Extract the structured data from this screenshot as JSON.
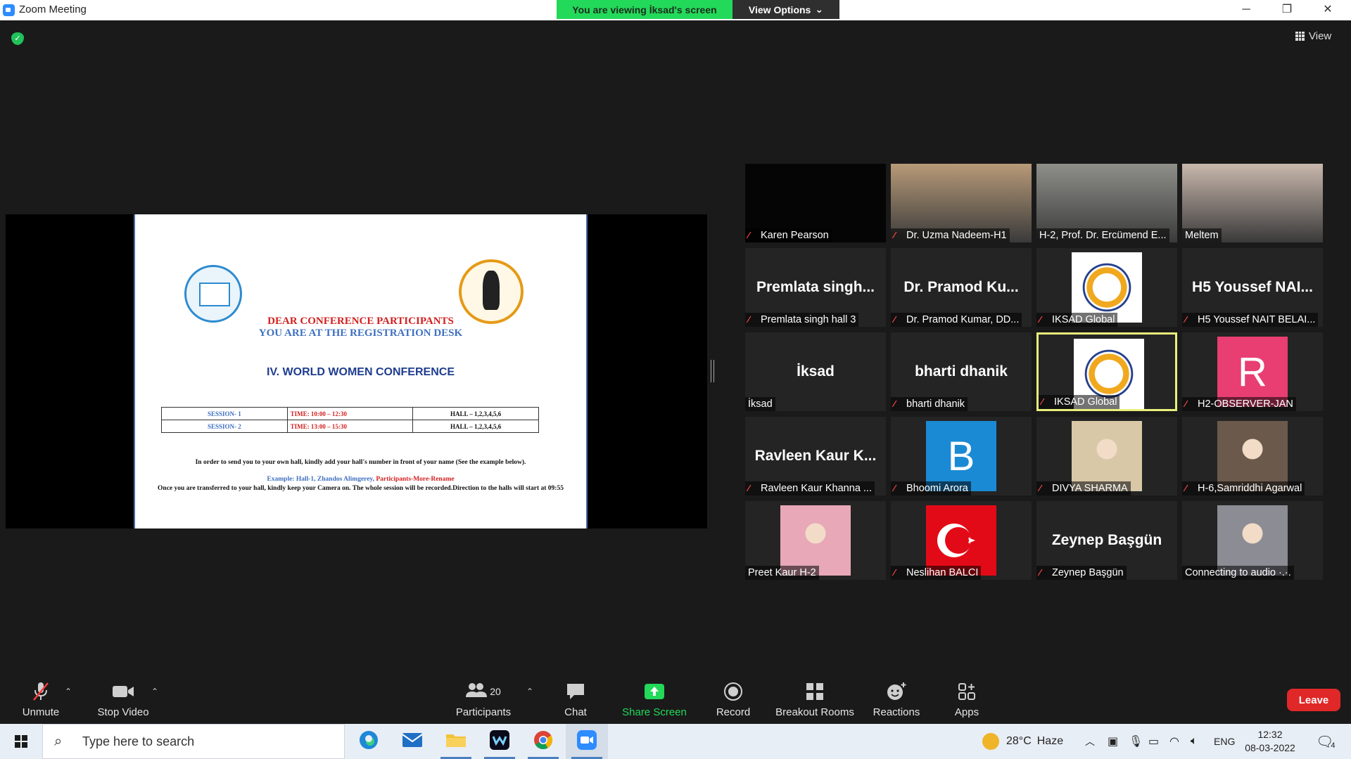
{
  "window": {
    "title": "Zoom Meeting",
    "banner": "You are viewing İksad's screen",
    "view_options": "View Options"
  },
  "view_button": {
    "label": "View"
  },
  "slide": {
    "line1": "DEAR CONFERENCE PARTICIPANTS",
    "line2": "YOU ARE AT THE REGISTRATION DESK",
    "title": "IV. WORLD WOMEN CONFERENCE",
    "sessions": [
      {
        "session": "SESSION- 1",
        "time": "TIME: 10:00 – 12:30",
        "hall": "HALL – 1,2,3,4,5,6"
      },
      {
        "session": "SESSION- 2",
        "time": "TIME: 13:00 – 15:30",
        "hall": "HALL – 1,2,3,4,5,6"
      }
    ],
    "instruction": "In order to send you to your own hall, kindly add your hall's number in front of your name (See the example below).",
    "example_blue": "Example: Hall-1, Zhandos Alimgerey,",
    "example_red": "Participants-More-Rename",
    "note": "Once you are transferred to your hall, kindly keep your Camera on. The whole session will be recorded.Direction to the halls will start at 09:55"
  },
  "participants": [
    {
      "name": "Karen Pearson",
      "muted": true,
      "display": "",
      "kind": "dark"
    },
    {
      "name": "Dr. Uzma Nadeem-H1",
      "muted": true,
      "display": "",
      "kind": "video",
      "color": "#b89a78"
    },
    {
      "name": "H-2, Prof. Dr. Ercümend E...",
      "muted": false,
      "display": "",
      "kind": "video",
      "color": "#8f8f8a"
    },
    {
      "name": "Meltem",
      "muted": false,
      "display": "",
      "kind": "video",
      "color": "#c9b8ad"
    },
    {
      "name": "Premlata singh hall 3",
      "muted": true,
      "display": "Premlata singh...",
      "kind": "text"
    },
    {
      "name": "Dr. Pramod Kumar, DD...",
      "muted": true,
      "display": "Dr. Pramod Ku...",
      "kind": "text"
    },
    {
      "name": "IKSAD Global",
      "muted": true,
      "display": "",
      "kind": "logo"
    },
    {
      "name": "H5 Youssef NAIT BELAI...",
      "muted": true,
      "display": "H5 Youssef NAI...",
      "kind": "text"
    },
    {
      "name": "İksad",
      "muted": false,
      "display": "İksad",
      "kind": "text"
    },
    {
      "name": "bharti dhanik",
      "muted": true,
      "display": "bharti dhanik",
      "kind": "text"
    },
    {
      "name": "IKSAD Global",
      "muted": true,
      "display": "",
      "kind": "logo",
      "active": true
    },
    {
      "name": "H2-OBSERVER-JAN",
      "muted": true,
      "display": "R",
      "kind": "letter",
      "color": "#e83e72"
    },
    {
      "name": "Ravleen Kaur Khanna ...",
      "muted": true,
      "display": "Ravleen Kaur K...",
      "kind": "text"
    },
    {
      "name": "Bhoomi Arora",
      "muted": true,
      "display": "B",
      "kind": "letter",
      "color": "#1a8ad4"
    },
    {
      "name": "DIVYA SHARMA",
      "muted": true,
      "display": "",
      "kind": "photo",
      "color": "#d8c8a8"
    },
    {
      "name": "H-6,Samriddhi Agarwal",
      "muted": true,
      "display": "",
      "kind": "photo",
      "color": "#6b5a4c"
    },
    {
      "name": "Preet Kaur H-2",
      "muted": false,
      "display": "",
      "kind": "photo",
      "color": "#e8a8b8"
    },
    {
      "name": "Neslihan BALCI",
      "muted": true,
      "display": "",
      "kind": "flag"
    },
    {
      "name": "Zeynep Başgün",
      "muted": true,
      "display": "Zeynep Başgün",
      "kind": "text"
    },
    {
      "name": "Connecting to audio ·.·.",
      "muted": false,
      "display": "",
      "kind": "photo",
      "color": "#8c8c94"
    }
  ],
  "toolbar": {
    "unmute": "Unmute",
    "stop_video": "Stop Video",
    "participants": "Participants",
    "participant_count": "20",
    "chat": "Chat",
    "share_screen": "Share Screen",
    "record": "Record",
    "breakout_rooms": "Breakout Rooms",
    "reactions": "Reactions",
    "apps": "Apps",
    "leave": "Leave"
  },
  "taskbar": {
    "search_placeholder": "Type here to search",
    "weather_temp": "28°C",
    "weather_text": "Haze",
    "lang": "ENG",
    "time": "12:32",
    "date": "08-03-2022",
    "notifications": "4"
  },
  "colors": {
    "accent_green": "#23d959",
    "share_green": "#23d959",
    "leave_red": "#e02828",
    "active_border": "#e8f07a"
  }
}
